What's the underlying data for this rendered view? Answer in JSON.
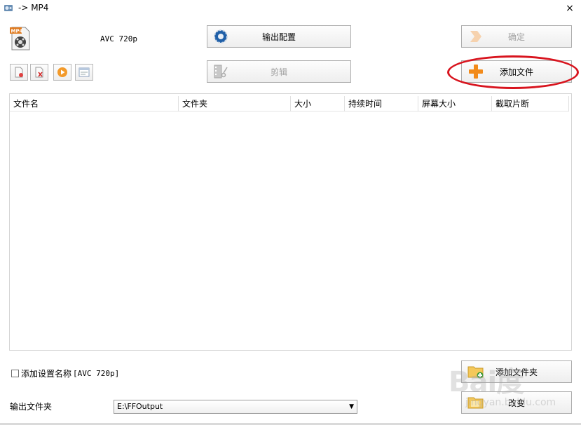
{
  "window": {
    "title": "-> MP4",
    "close_glyph": "×"
  },
  "format": {
    "label": "AVC 720p",
    "icon": "mp4-file-icon",
    "badge": "MP4"
  },
  "toolbar": {
    "output_config_label": "输出配置",
    "edit_label": "剪辑",
    "ok_label": "确定",
    "add_file_label": "添加文件",
    "small_buttons": [
      "remove-file-icon",
      "clear-list-icon",
      "play-icon",
      "media-info-icon"
    ]
  },
  "table": {
    "columns": [
      "文件名",
      "文件夹",
      "大小",
      "持续时间",
      "屏幕大小",
      "截取片断"
    ],
    "rows": []
  },
  "bottom": {
    "add_setting_name_label": "添加设置名称",
    "add_setting_name_value": "[AVC 720p]",
    "add_setting_checked": false,
    "output_folder_label": "输出文件夹",
    "output_folder_value": "E:\\FFOutput",
    "add_folder_label": "添加文件夹",
    "change_label": "改变"
  },
  "watermark": {
    "text": "Bai度",
    "sub": "jingyan.baidu.com"
  },
  "colors": {
    "highlight": "#d8141e",
    "accent_orange": "#f28a1a",
    "border": "#adadad"
  }
}
